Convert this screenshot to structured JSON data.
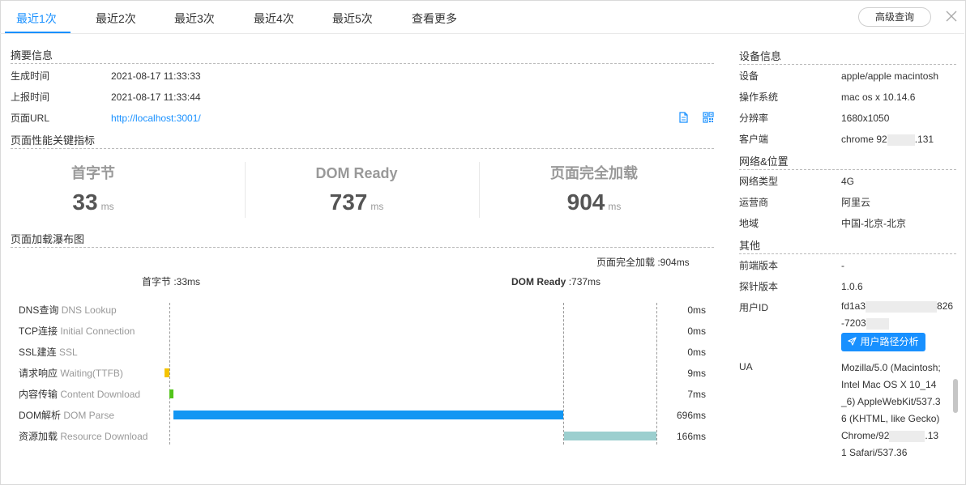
{
  "tabs": [
    {
      "label": "最近1次",
      "active": true
    },
    {
      "label": "最近2次"
    },
    {
      "label": "最近3次"
    },
    {
      "label": "最近4次"
    },
    {
      "label": "最近5次"
    },
    {
      "label": "查看更多"
    }
  ],
  "toolbar": {
    "advanced_query": "高级查询",
    "close_icon": "close-icon"
  },
  "summary": {
    "title": "摘要信息",
    "generated_label": "生成时间",
    "generated_value": "2021-08-17 11:33:33",
    "reported_label": "上报时间",
    "reported_value": "2021-08-17 11:33:44",
    "url_label": "页面URL",
    "url_value": "http://localhost:3001/",
    "copy_icon": "copy-icon",
    "qrcode_icon": "qrcode-icon"
  },
  "metrics": {
    "title": "页面性能关键指标",
    "items": [
      {
        "name": "首字节",
        "value": "33",
        "unit": "ms"
      },
      {
        "name": "DOM Ready",
        "value": "737",
        "unit": "ms"
      },
      {
        "name": "页面完全加载",
        "value": "904",
        "unit": "ms"
      }
    ]
  },
  "waterfall": {
    "title": "页面加载瀑布图",
    "full_load_marker": "页面完全加载 :904ms",
    "first_byte_marker": "首字节 :33ms",
    "dom_ready_marker_name": "DOM Ready",
    "dom_ready_marker_value": " :737ms",
    "rows": [
      {
        "cn": "DNS查询",
        "en": "DNS Lookup",
        "ms": "0ms",
        "start": 0,
        "duration": 0,
        "color": "#1890ff"
      },
      {
        "cn": "TCP连接",
        "en": "Initial Connection",
        "ms": "0ms",
        "start": 0,
        "duration": 0,
        "color": "#1890ff"
      },
      {
        "cn": "SSL建连",
        "en": "SSL",
        "ms": "0ms",
        "start": 0,
        "duration": 0,
        "color": "#1890ff"
      },
      {
        "cn": "请求响应",
        "en": "Waiting(TTFB)",
        "ms": "9ms",
        "start": 0,
        "duration": 9,
        "color": "#f5c400"
      },
      {
        "cn": "内容传输",
        "en": "Content Download",
        "ms": "7ms",
        "start": 0,
        "duration": 7,
        "color": "#52c41a"
      },
      {
        "cn": "DOM解析",
        "en": "DOM Parse",
        "ms": "696ms",
        "start": 7,
        "duration": 696,
        "color": "#1296f3"
      },
      {
        "cn": "资源加载",
        "en": "Resource Download",
        "ms": "166ms",
        "start": 737,
        "duration": 166,
        "color": "#9ccfcf"
      }
    ]
  },
  "device": {
    "title": "设备信息",
    "device_label": "设备",
    "device_value": "apple/apple macintosh",
    "os_label": "操作系统",
    "os_value": "mac os x 10.14.6",
    "resolution_label": "分辨率",
    "resolution_value": "1680x1050",
    "client_label": "客户端",
    "client_value_a": "chrome 92",
    "client_value_b": ".131"
  },
  "network": {
    "title": "网络&位置",
    "type_label": "网络类型",
    "type_value": "4G",
    "carrier_label": "运营商",
    "carrier_value": "阿里云",
    "region_label": "地域",
    "region_value": "中国-北京-北京"
  },
  "other": {
    "title": "其他",
    "frontend_label": "前端版本",
    "frontend_value": "-",
    "probe_label": "探针版本",
    "probe_value": "1.0.6",
    "uid_label": "用户ID",
    "uid_value_a": "fd1a3",
    "uid_value_b": "826",
    "uid_value_c": "-7203",
    "path_button": "用户路径分析",
    "ua_label": "UA",
    "ua_value_a": "Mozilla/5.0 (Macintosh; Intel Mac OS X 10_14_6) AppleWebKit/537.36 (KHTML, like Gecko) Chrome/92",
    "ua_value_b": ".131 Safari/537.36"
  }
}
